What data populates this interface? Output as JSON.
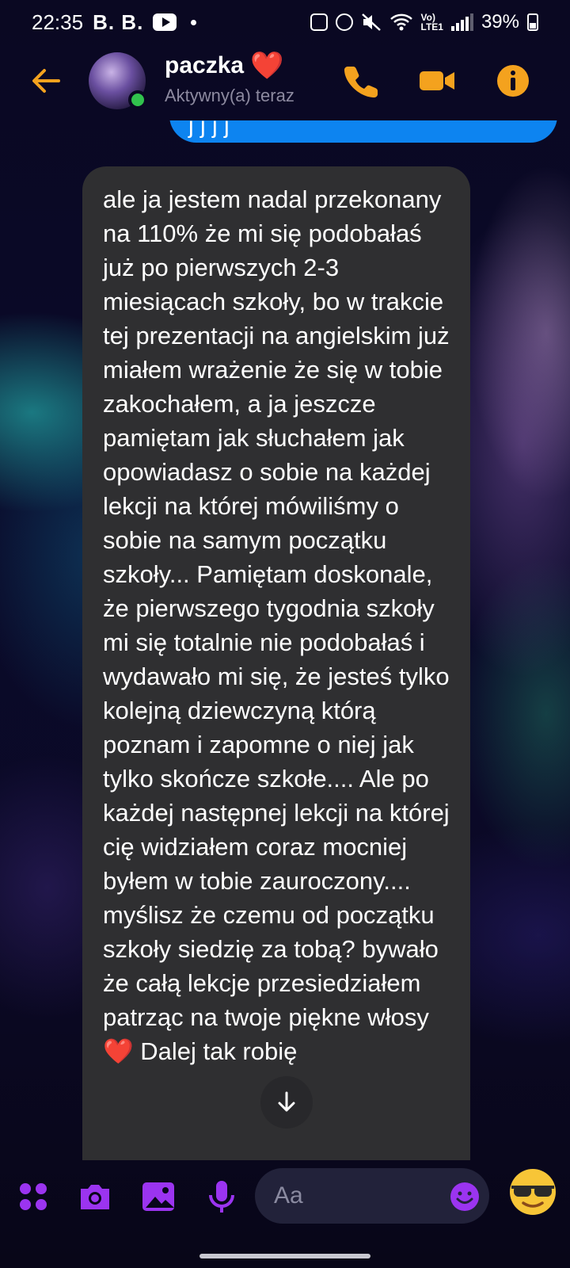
{
  "status_bar": {
    "time": "22:35",
    "carrier_text": "B. B.",
    "network_label": "Vo)\nLTE1",
    "battery": "39%"
  },
  "header": {
    "contact_name": "paczka",
    "contact_emoji": "❤️",
    "presence": "Aktywny(a) teraz",
    "icons": {
      "back": "back-arrow-icon",
      "call": "phone-icon",
      "video": "video-camera-icon",
      "info": "info-icon"
    }
  },
  "messages": {
    "previous_sent_fragment": "j   j  j  j ",
    "received_text": "ale ja jestem nadal przekonany na 110% że mi się podobałaś już po pierwszych 2-3 miesiącach szkoły, bo w trakcie tej prezentacji na angielskim już miałem wrażenie że się w tobie zakochałem, a ja jeszcze pamiętam jak słuchałem jak opowiadasz o sobie na każdej lekcji na której mówiliśmy o sobie na samym początku szkoły... Pamiętam doskonale, że pierwszego tygodnia szkoły mi się totalnie nie podobałaś i wydawało mi się, że jesteś tylko kolejną dziewczyną którą poznam i zapomne o niej jak tylko skończe szkołe.... Ale po każdej następnej lekcji na której cię widziałem coraz mocniej byłem w tobie zauroczony.... myślisz że czemu od początku szkoły siedzię za tobą? bywało że całą lekcje przesiedziałem patrząc na twoje piękne włosy ❤️ Dalej tak robię"
  },
  "composer": {
    "placeholder": "Aa",
    "quick_reaction": "😎",
    "icons": [
      "apps-icon",
      "camera-icon",
      "gallery-icon",
      "microphone-icon",
      "emoji-icon"
    ]
  },
  "colors": {
    "accent_orange": "#f4a21e",
    "accent_purple": "#9b34f0",
    "sent_bubble": "#0d84f0",
    "received_bubble": "#2f2f31",
    "online": "#31c24d"
  }
}
